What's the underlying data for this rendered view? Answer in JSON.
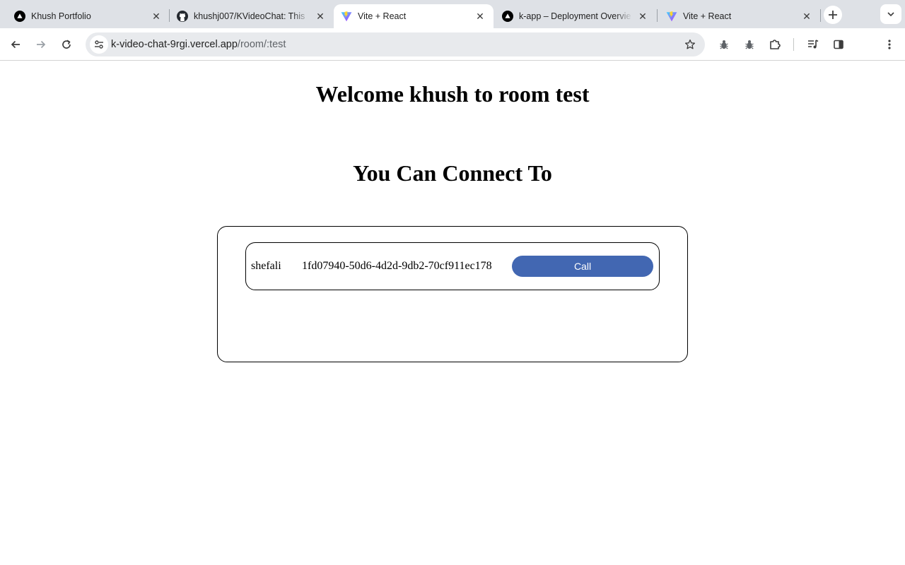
{
  "browser": {
    "tabs": [
      {
        "title": "Khush Portfolio",
        "favicon": "vercel-icon",
        "active": false
      },
      {
        "title": "khushj007/KVideoChat: This",
        "favicon": "github-icon",
        "active": false
      },
      {
        "title": "Vite + React",
        "favicon": "vite-icon",
        "active": true
      },
      {
        "title": "k-app – Deployment Overvie",
        "favicon": "vercel-icon",
        "active": false
      },
      {
        "title": "Vite + React",
        "favicon": "vite-icon",
        "active": false
      }
    ],
    "address": {
      "host": "k-video-chat-9rgi.vercel.app",
      "path": "/room/:test"
    }
  },
  "page": {
    "welcome": "Welcome khush to room test",
    "connect_heading": "You Can Connect To",
    "users": [
      {
        "name": "shefali",
        "id": "1fd07940-50d6-4d2d-9db2-70cf911ec178",
        "call_label": "Call"
      }
    ]
  },
  "colors": {
    "tabstrip_bg": "#dee1e6",
    "omnibox_bg": "#e8eaed",
    "call_button": "#4267b2"
  }
}
